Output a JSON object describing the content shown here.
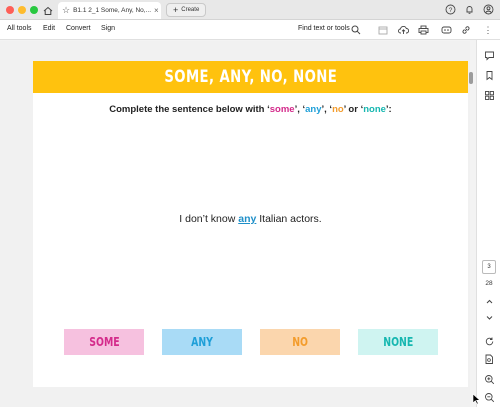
{
  "titlebar": {
    "tab_title": "B1.1 2_1 Some, Any, No,...",
    "new_tab_label": "Create"
  },
  "menubar": {
    "items": [
      "All tools",
      "Edit",
      "Convert",
      "Sign"
    ],
    "find_label": "Find text or tools"
  },
  "page": {
    "banner_title": "SOME, ANY, NO, NONE",
    "instruction": {
      "prefix": "Complete the sentence below with ‘",
      "some": "some",
      "sep1": "’, ‘",
      "any": "any",
      "sep2": "’, ‘",
      "no": "no",
      "sep3": "’ or ‘",
      "none": "none",
      "suffix": "’:"
    },
    "sentence": {
      "before": "I don’t know ",
      "answer": "any",
      "after": " Italian actors."
    },
    "options": [
      "SOME",
      "ANY",
      "NO",
      "NONE"
    ]
  },
  "sidebar": {
    "current_page": "3",
    "total_pages": "28"
  },
  "colors": {
    "banner": "#ffc20e",
    "some": "#d42b8b",
    "any": "#1e9fd8",
    "no": "#f39c2c",
    "none": "#16b7b0"
  }
}
